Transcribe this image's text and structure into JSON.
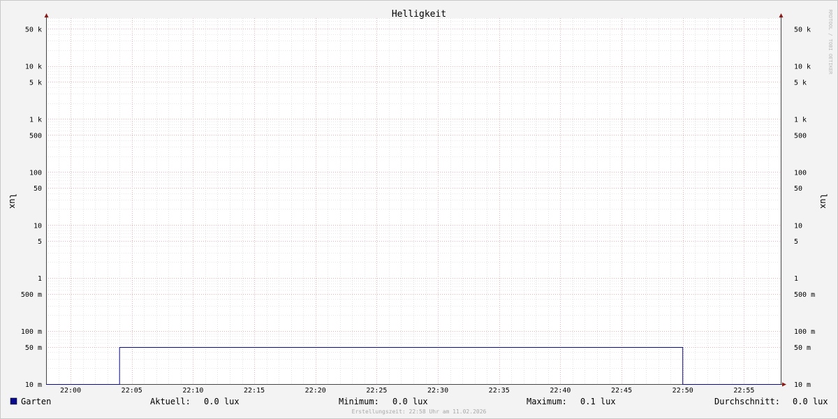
{
  "chart_data": {
    "type": "line",
    "title": "Helligkeit",
    "ylabel": "lux",
    "ylabel_right": "lux",
    "yscale": "log",
    "ylim": [
      0.01,
      80000
    ],
    "y_ticks": [
      {
        "value": 50000,
        "label": "50 k"
      },
      {
        "value": 10000,
        "label": "10 k"
      },
      {
        "value": 5000,
        "label": "5 k"
      },
      {
        "value": 1000,
        "label": "1 k"
      },
      {
        "value": 500,
        "label": "500"
      },
      {
        "value": 100,
        "label": "100"
      },
      {
        "value": 50,
        "label": "50"
      },
      {
        "value": 10,
        "label": "10"
      },
      {
        "value": 5,
        "label": "5"
      },
      {
        "value": 1,
        "label": "1"
      },
      {
        "value": 0.5,
        "label": "500 m"
      },
      {
        "value": 0.1,
        "label": "100 m"
      },
      {
        "value": 0.05,
        "label": "50 m"
      },
      {
        "value": 0.01,
        "label": "10 m"
      }
    ],
    "xlim": [
      "21:58",
      "22:58"
    ],
    "x_ticks": [
      "22:00",
      "22:05",
      "22:10",
      "22:15",
      "22:20",
      "22:25",
      "22:30",
      "22:35",
      "22:40",
      "22:45",
      "22:50",
      "22:55"
    ],
    "grid": true,
    "series": [
      {
        "name": "Garten",
        "color": "#0a0a8c",
        "points": [
          [
            "21:58",
            0.01
          ],
          [
            "22:04",
            0.01
          ],
          [
            "22:04",
            0.05
          ],
          [
            "22:50",
            0.05
          ],
          [
            "22:50",
            0.01
          ],
          [
            "22:58",
            0.01
          ]
        ]
      }
    ],
    "legend": {
      "series_name": "Garten",
      "swatch_color": "#0a0a8c",
      "stats": [
        {
          "label": "Aktuell:",
          "value": "0.0 lux"
        },
        {
          "label": "Minimum:",
          "value": "0.0 lux"
        },
        {
          "label": "Maximum:",
          "value": "0.1 lux"
        },
        {
          "label": "Durchschnitt:",
          "value": "0.0 lux"
        }
      ]
    },
    "footer": "Erstellungszeit: 22:58 Uhr am 11.02.2026",
    "watermark": "RRDTOOL / TOBI OETIKER",
    "colors": {
      "background": "#f3f3f3",
      "plot_background": "#ffffff",
      "major_grid": "#e8a0a0",
      "minor_grid": "#d0d0d0",
      "axis": "#444444",
      "arrow": "#8b1a1a"
    }
  }
}
